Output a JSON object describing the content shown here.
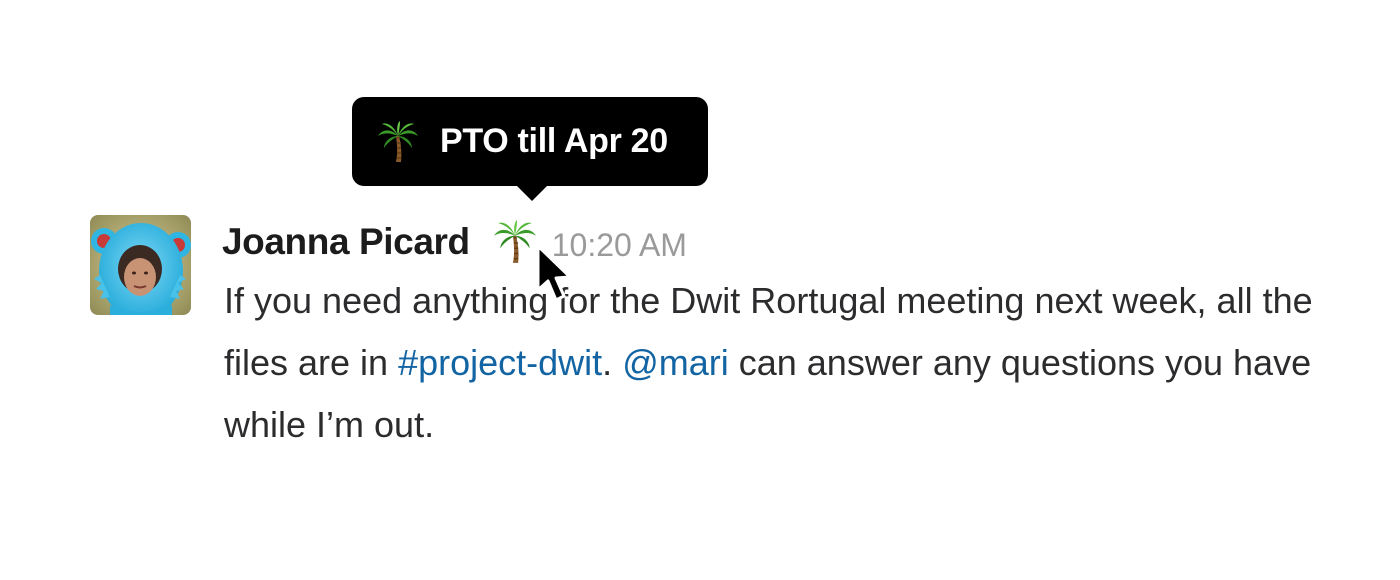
{
  "status_tooltip": {
    "text": "PTO till Apr 20",
    "icon": "palm-tree-icon"
  },
  "message": {
    "author": "Joanna Picard",
    "status_emoji": "palm-tree-icon",
    "timestamp": "10:20 AM",
    "avatar": "user-avatar",
    "body": {
      "text_1": "If you need anything for the Dwit Rortugal meeting next week, all the files are in ",
      "channel_link": "#project-dwit",
      "text_2": ". ",
      "mention": "@mari",
      "text_3": " can answer any questions you have while I’m out."
    }
  },
  "colors": {
    "link": "#1264a3",
    "timestamp": "#9a9a9a",
    "tooltip_bg": "#000000"
  }
}
